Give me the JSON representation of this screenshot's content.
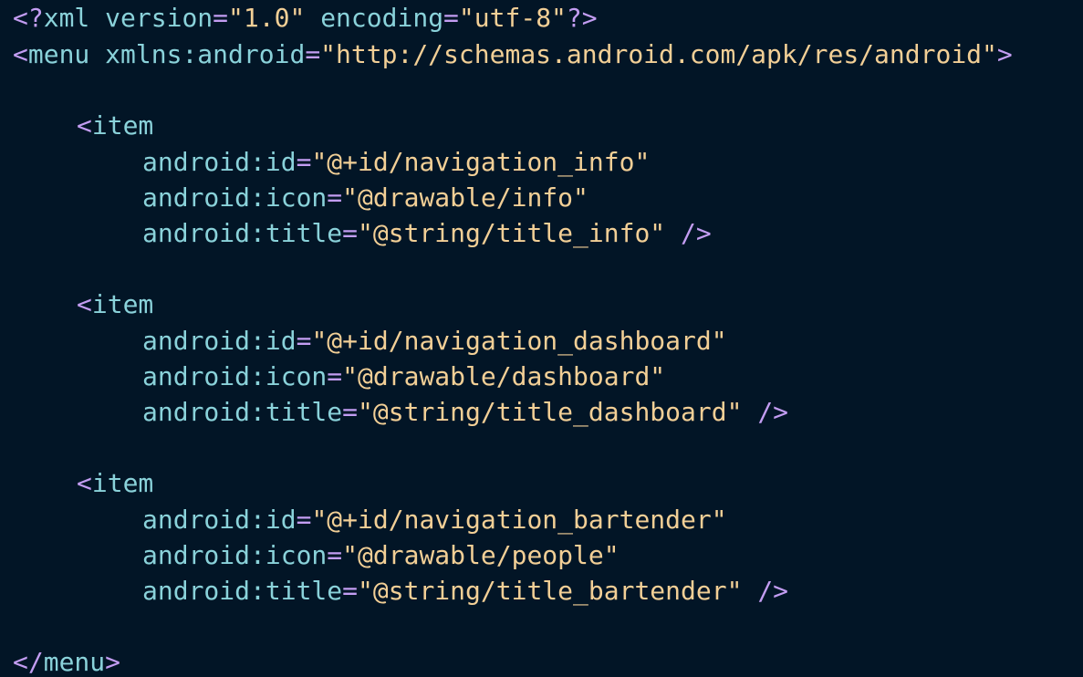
{
  "colors": {
    "background": "#021526",
    "bracket": "#c39df2",
    "tag": "#8ad2da",
    "attribute": "#8ad2da",
    "string": "#f2cf96"
  },
  "code": {
    "decl": {
      "open": "<?",
      "name": "xml",
      "attr1": "version",
      "val1": "\"1.0\"",
      "attr2": "encoding",
      "val2": "\"utf-8\"",
      "close": "?>"
    },
    "menu_open": {
      "open": "<",
      "name": "menu",
      "attr": "xmlns:android",
      "val": "\"http://schemas.android.com/apk/res/android\"",
      "close": ">"
    },
    "items": [
      {
        "open": "<",
        "name": "item",
        "id_attr": "android:id",
        "id_val": "\"@+id/navigation_info\"",
        "icon_attr": "android:icon",
        "icon_val": "\"@drawable/info\"",
        "title_attr": "android:title",
        "title_val": "\"@string/title_info\"",
        "close": "/>"
      },
      {
        "open": "<",
        "name": "item",
        "id_attr": "android:id",
        "id_val": "\"@+id/navigation_dashboard\"",
        "icon_attr": "android:icon",
        "icon_val": "\"@drawable/dashboard\"",
        "title_attr": "android:title",
        "title_val": "\"@string/title_dashboard\"",
        "close": "/>"
      },
      {
        "open": "<",
        "name": "item",
        "id_attr": "android:id",
        "id_val": "\"@+id/navigation_bartender\"",
        "icon_attr": "android:icon",
        "icon_val": "\"@drawable/people\"",
        "title_attr": "android:title",
        "title_val": "\"@string/title_bartender\"",
        "close": "/>"
      }
    ],
    "menu_close": {
      "open": "</",
      "name": "menu",
      "close": ">"
    },
    "equals": "="
  }
}
